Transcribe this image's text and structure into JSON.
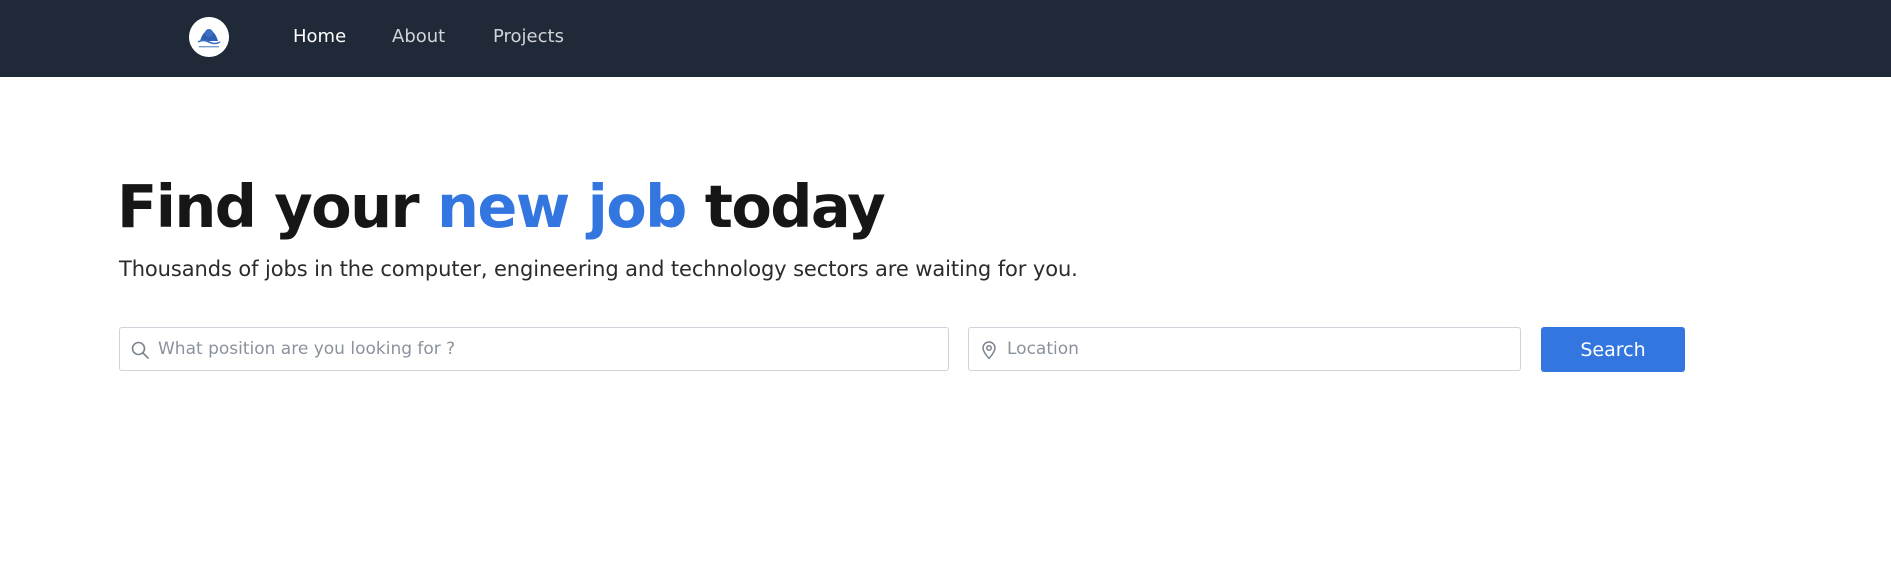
{
  "nav": {
    "logo_icon": "company-logo-icon",
    "links": [
      {
        "label": "Home",
        "active": true
      },
      {
        "label": "About",
        "active": false
      },
      {
        "label": "Projects",
        "active": false
      }
    ]
  },
  "hero": {
    "title_start": "Find your ",
    "title_accent": "new job",
    "title_end": " today",
    "subtitle": "Thousands of jobs in the computer, engineering and technology sectors are waiting for you."
  },
  "search": {
    "position_placeholder": "What position are you looking for ?",
    "position_icon": "search-icon",
    "location_placeholder": "Location",
    "location_icon": "map-pin-icon",
    "button_label": "Search"
  },
  "colors": {
    "navbar_bg": "#1f2937",
    "accent": "#3476e0",
    "heading": "#161616"
  }
}
